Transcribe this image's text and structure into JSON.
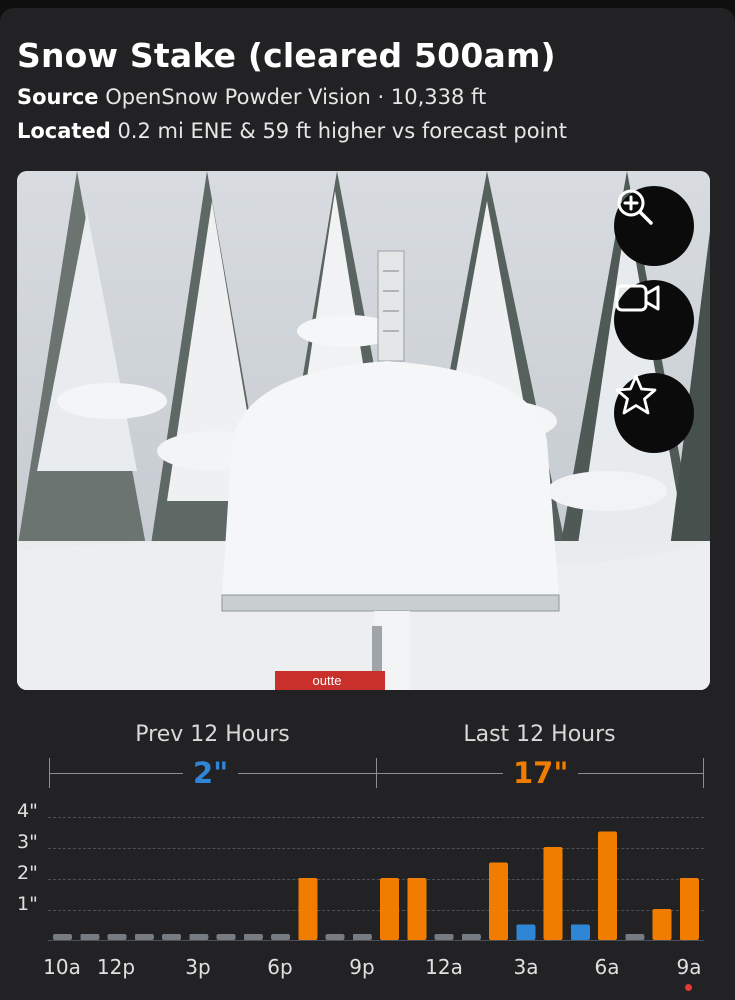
{
  "header": {
    "title": "Snow Stake (cleared 500am)",
    "source_label": "Source",
    "source_value": "OpenSnow Powder Vision · 10,338 ft",
    "located_label": "Located",
    "located_value": "0.2 mi ENE & 59 ft higher vs forecast point"
  },
  "camera": {
    "stake_brand_text": "outte",
    "buttons": [
      {
        "name": "zoom-in-icon"
      },
      {
        "name": "video-camera-icon"
      },
      {
        "name": "star-icon"
      }
    ]
  },
  "summary": {
    "prev_label": "Prev 12 Hours",
    "prev_total": "2\"",
    "last_label": "Last 12 Hours",
    "last_total": "17\"",
    "prev_color": "#2f86d6",
    "last_color": "#f07d00"
  },
  "chart_data": {
    "type": "bar",
    "ylabel_ticks": [
      "1\"",
      "2\"",
      "3\"",
      "4\""
    ],
    "ylim": [
      0,
      4
    ],
    "x_tick_labels": [
      "10a",
      "12p",
      "3p",
      "6p",
      "9p",
      "12a",
      "3a",
      "6a",
      "9a"
    ],
    "values": [
      0,
      0,
      0,
      0,
      0,
      0,
      0,
      0,
      0,
      2,
      0,
      0,
      2,
      2,
      0,
      0,
      2.5,
      0.5,
      3,
      0.5,
      3.5,
      0,
      1,
      2
    ],
    "colors": [
      "gray",
      "gray",
      "gray",
      "gray",
      "gray",
      "gray",
      "gray",
      "gray",
      "gray",
      "orange",
      "gray",
      "gray",
      "orange",
      "orange",
      "gray",
      "gray",
      "orange",
      "blue",
      "orange",
      "blue",
      "orange",
      "gray",
      "orange",
      "orange"
    ],
    "palette": {
      "gray": "#777b82",
      "orange": "#f07d00",
      "blue": "#2f86d6"
    }
  }
}
